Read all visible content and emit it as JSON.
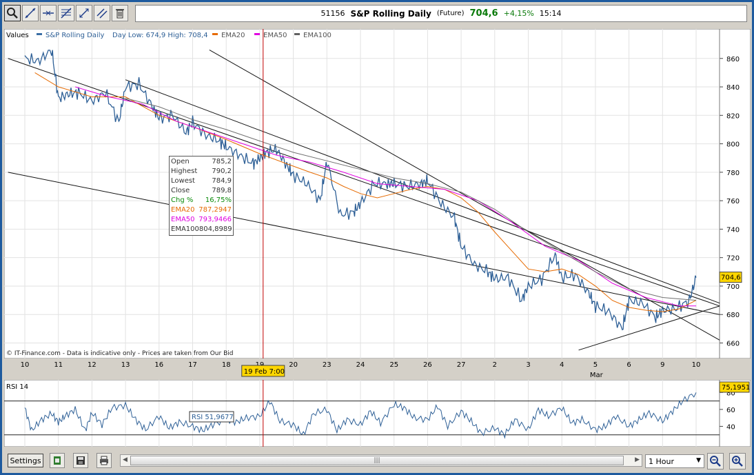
{
  "toolbar": {
    "tools": [
      "zoom-tool",
      "line-tool",
      "horizontal-line-tool",
      "fibonacci-tool",
      "extend-line-tool",
      "parallel-line-tool",
      "delete-tool"
    ]
  },
  "header": {
    "code": "51156",
    "name": "S&P Rolling Daily",
    "type": "(Future)",
    "price": "704,6",
    "change": "+4,15%",
    "time": "15:14"
  },
  "legend": {
    "values_label": "Values",
    "items": [
      {
        "label": "S&P Rolling Daily",
        "color": "#3a6ea5"
      },
      {
        "label": "Day Low: 674,9 High: 708,4",
        "color": ""
      },
      {
        "label": "EMA20",
        "color": "#e66a00"
      },
      {
        "label": "EMA50",
        "color": "#e000e0"
      },
      {
        "label": "EMA100",
        "color": "#606060"
      }
    ]
  },
  "disclaimer": "© IT-Finance.com - Data is indicative only - Prices are taken from Our Bid",
  "price_label": "704,6",
  "cursor_label": "19 Feb 7:00",
  "month_label": "Mar",
  "tooltip": {
    "rows": [
      {
        "label": "Open",
        "value": "785,2",
        "color": "#333333"
      },
      {
        "label": "Highest",
        "value": "790,2",
        "color": "#333333"
      },
      {
        "label": "Lowest",
        "value": "784,9",
        "color": "#333333"
      },
      {
        "label": "Close",
        "value": "789,8",
        "color": "#333333"
      },
      {
        "label": "Chg %",
        "value": "16,75%",
        "color": "#0a8a0a"
      },
      {
        "label": "EMA20",
        "value": "787,2947",
        "color": "#e66a00"
      },
      {
        "label": "EMA50",
        "value": "793,9466",
        "color": "#e000e0"
      },
      {
        "label": "EMA100",
        "value": "804,8989",
        "color": "#333333"
      }
    ]
  },
  "rsi": {
    "title": "RSI 14",
    "readout": "RSI 51,9677",
    "last_label": "75,1951"
  },
  "bottom": {
    "settings_label": "Settings",
    "interval": "1 Hour"
  },
  "chart_data": {
    "type": "line",
    "title": "S&P Rolling Daily",
    "x_ticks": [
      "10",
      "11",
      "12",
      "13",
      "16",
      "17",
      "18",
      "19",
      "20",
      "23",
      "24",
      "25",
      "26",
      "27",
      "2",
      "3",
      "4",
      "5",
      "6",
      "9",
      "10"
    ],
    "y_ticks": [
      860,
      840,
      820,
      800,
      780,
      760,
      740,
      720,
      700,
      680,
      660
    ],
    "ylim": [
      652,
      872
    ],
    "grid": true,
    "series": [
      {
        "name": "S&P Rolling Daily",
        "color": "#2d5f96",
        "x": [
          0,
          0.4,
          0.8,
          1.0,
          1.3,
          1.6,
          2.0,
          2.4,
          2.8,
          3.0,
          3.4,
          3.8,
          4.0,
          4.4,
          4.8,
          5.0,
          5.4,
          5.8,
          6.0,
          6.4,
          6.8,
          7.0,
          7.2,
          7.5,
          7.8,
          8.0,
          8.4,
          8.8,
          9.0,
          9.4,
          9.8,
          10.0,
          10.4,
          10.8,
          11.0,
          11.4,
          11.8,
          12.0,
          12.4,
          12.8,
          13.0,
          13.4,
          13.8,
          14.0,
          14.4,
          14.8,
          15.0,
          15.4,
          15.8,
          16.0,
          16.4,
          16.8,
          17.0,
          17.4,
          17.8,
          18.0,
          18.4,
          18.8,
          19.0,
          19.4,
          19.8,
          20.0
        ],
        "y": [
          860,
          858,
          866,
          832,
          835,
          836,
          830,
          836,
          815,
          840,
          842,
          826,
          818,
          820,
          808,
          815,
          806,
          802,
          798,
          792,
          786,
          790,
          794,
          796,
          785,
          778,
          772,
          760,
          788,
          750,
          752,
          758,
          772,
          772,
          772,
          770,
          772,
          774,
          758,
          748,
          728,
          715,
          710,
          705,
          706,
          690,
          700,
          705,
          722,
          706,
          708,
          695,
          686,
          682,
          670,
          690,
          688,
          678,
          683,
          684,
          690,
          706
        ]
      },
      {
        "name": "EMA20",
        "color": "#e66a00",
        "x": [
          0.3,
          1.0,
          2.0,
          3.0,
          4.0,
          5.0,
          6.0,
          7.0,
          7.8,
          8.5,
          9.0,
          9.5,
          10.0,
          10.5,
          11.0,
          11.5,
          12.0,
          12.5,
          13.0,
          13.5,
          14.0,
          14.5,
          15.0,
          15.5,
          16.0,
          16.5,
          17.0,
          17.5,
          18.0,
          18.5,
          19.0,
          19.5,
          20.0
        ],
        "y": [
          850,
          840,
          833,
          833,
          820,
          812,
          803,
          793,
          786,
          780,
          776,
          770,
          765,
          762,
          765,
          768,
          770,
          768,
          762,
          752,
          738,
          725,
          712,
          710,
          712,
          708,
          700,
          690,
          685,
          683,
          682,
          684,
          690
        ]
      },
      {
        "name": "EMA50",
        "color": "#e000e0",
        "x": [
          1.5,
          2.5,
          3.5,
          4.5,
          5.5,
          6.5,
          7.5,
          8.5,
          9.5,
          10.5,
          11.5,
          12.5,
          13.5,
          14.5,
          15.5,
          16.5,
          17.5,
          18.5,
          19.5,
          20.0
        ],
        "y": [
          840,
          833,
          828,
          816,
          808,
          800,
          792,
          787,
          780,
          772,
          770,
          768,
          760,
          745,
          728,
          718,
          702,
          692,
          686,
          686
        ]
      },
      {
        "name": "EMA100",
        "color": "#707070",
        "x": [
          3.0,
          4.0,
          5.0,
          6.0,
          7.0,
          8.0,
          9.0,
          10.0,
          11.0,
          12.0,
          13.0,
          14.0,
          15.0,
          16.0,
          17.0,
          18.0,
          19.0,
          20.0
        ],
        "y": [
          832,
          826,
          817,
          810,
          802,
          794,
          788,
          782,
          776,
          772,
          766,
          754,
          738,
          724,
          710,
          698,
          692,
          690
        ]
      }
    ],
    "trendlines": [
      {
        "x": [
          -0.5,
          20.7
        ],
        "y": [
          860,
          686
        ]
      },
      {
        "x": [
          5.5,
          20.7
        ],
        "y": [
          866,
          662
        ]
      },
      {
        "x": [
          -0.5,
          20.7
        ],
        "y": [
          780,
          680
        ]
      },
      {
        "x": [
          3.0,
          20.7
        ],
        "y": [
          845,
          688
        ]
      },
      {
        "x": [
          16.5,
          20.7
        ],
        "y": [
          655,
          686
        ]
      }
    ],
    "cursor_x": 7.1
  },
  "rsi_data": {
    "ylim": [
      20,
      90
    ],
    "y_ticks": [
      40,
      60,
      80
    ],
    "levels": [
      30,
      70
    ],
    "x": [
      0,
      0.2,
      0.5,
      0.8,
      1.0,
      1.2,
      1.5,
      1.8,
      2.0,
      2.3,
      2.6,
      3.0,
      3.3,
      3.6,
      4.0,
      4.3,
      4.6,
      5.0,
      5.3,
      5.6,
      6.0,
      6.3,
      6.6,
      7.0,
      7.3,
      7.6,
      8.0,
      8.3,
      8.6,
      9.0,
      9.3,
      9.6,
      10.0,
      10.3,
      10.6,
      11.0,
      11.3,
      11.6,
      12.0,
      12.3,
      12.6,
      13.0,
      13.3,
      13.6,
      14.0,
      14.3,
      14.6,
      15.0,
      15.3,
      15.6,
      16.0,
      16.3,
      16.6,
      17.0,
      17.3,
      17.6,
      18.0,
      18.3,
      18.6,
      19.0,
      19.3,
      19.6,
      20.0
    ],
    "y": [
      62,
      35,
      48,
      55,
      45,
      52,
      60,
      35,
      56,
      42,
      62,
      65,
      48,
      36,
      52,
      38,
      45,
      40,
      35,
      42,
      48,
      45,
      50,
      52,
      70,
      46,
      42,
      30,
      55,
      60,
      35,
      48,
      42,
      58,
      44,
      66,
      62,
      50,
      48,
      64,
      40,
      58,
      46,
      32,
      38,
      30,
      48,
      36,
      60,
      52,
      62,
      44,
      48,
      36,
      40,
      52,
      40,
      48,
      56,
      46,
      58,
      70,
      80
    ]
  }
}
